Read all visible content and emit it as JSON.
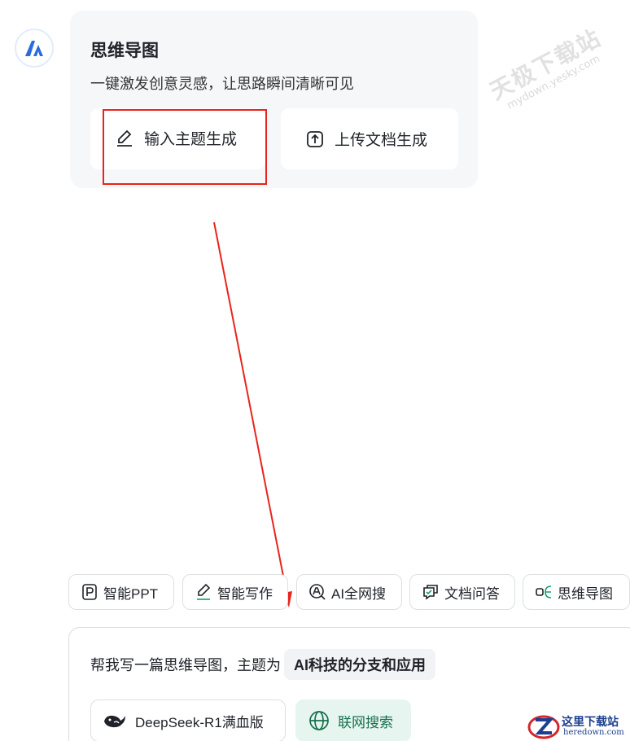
{
  "card": {
    "title": "思维导图",
    "subtitle": "一键激发创意灵感，让思路瞬间清晰可见",
    "btn_topic": "输入主题生成",
    "btn_upload": "上传文档生成"
  },
  "tools": [
    {
      "label": "智能PPT",
      "icon": "ppt-icon"
    },
    {
      "label": "智能写作",
      "icon": "pen-icon"
    },
    {
      "label": "AI全网搜",
      "icon": "ai-search-icon"
    },
    {
      "label": "文档问答",
      "icon": "chat-doc-icon"
    },
    {
      "label": "思维导图",
      "icon": "mindmap-icon"
    }
  ],
  "input": {
    "prompt_prefix": "帮我写一篇思维导图，主题为",
    "topic": "AI科技的分支和应用"
  },
  "model_button": "DeepSeek-R1满血版",
  "web_search_button": "联网搜索",
  "watermark": {
    "main": "天极下载站",
    "sub": "mydown.yesky.com"
  },
  "corner_logo": {
    "main": "这里下载站",
    "sub": "heredown.com"
  },
  "colors": {
    "highlight_red": "#e8241c",
    "brand_blue": "#2a6be0",
    "web_search_green": "#17704f"
  }
}
